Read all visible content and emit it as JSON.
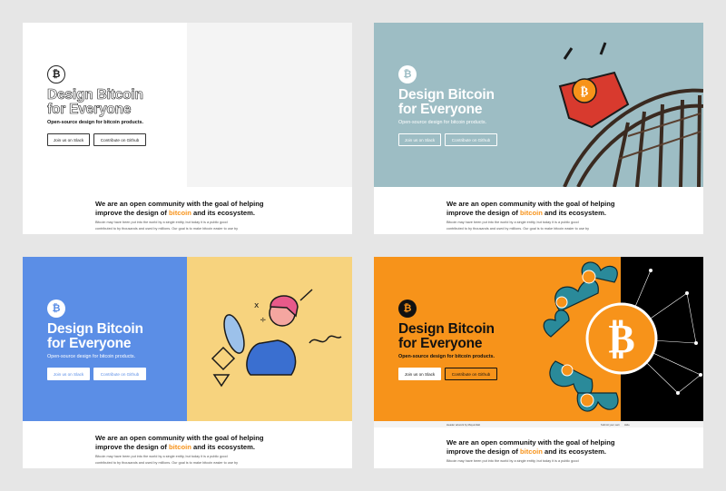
{
  "variants": {
    "v1": {
      "colors": {
        "left": "#ffffff",
        "right": "#f4f4f4",
        "text": "#111111"
      }
    },
    "v2": {
      "colors": {
        "bg": "#9dbdc4",
        "text": "#ffffff"
      }
    },
    "v3": {
      "colors": {
        "left": "#5b8ee6",
        "right": "#f7d37e",
        "text": "#ffffff"
      }
    },
    "v4": {
      "colors": {
        "left": "#f7931a",
        "right": "#000000",
        "text": "#111111"
      }
    }
  },
  "hero": {
    "logo_glyph": "₿",
    "title_line1": "Design Bitcoin",
    "title_line2": "for Everyone",
    "subtitle": "Open-source design for bitcoin products.",
    "btn_slack": "Join us on Slack",
    "btn_github": "Contribute on Github"
  },
  "body": {
    "heading_pre": "We are an open community with the goal of helping improve the design of ",
    "heading_highlight": "bitcoin",
    "heading_post": " and its ecosystem.",
    "paragraph_line1": "Bitcoin may have been put into the world by a single entity, but today it is a public good",
    "paragraph_line2": "contributed to by thousands and used by millions. Our goal is to make bitcoin easier to use by"
  },
  "credit": {
    "left": "Header artwork by Mayumilab",
    "right_a": "Submit your own",
    "right_b": "Hide"
  },
  "icons": [
    "bitcoin-logo-icon",
    "rollercoaster-illustration",
    "woman-phone-illustration",
    "bitcoin-wave-illustration"
  ]
}
